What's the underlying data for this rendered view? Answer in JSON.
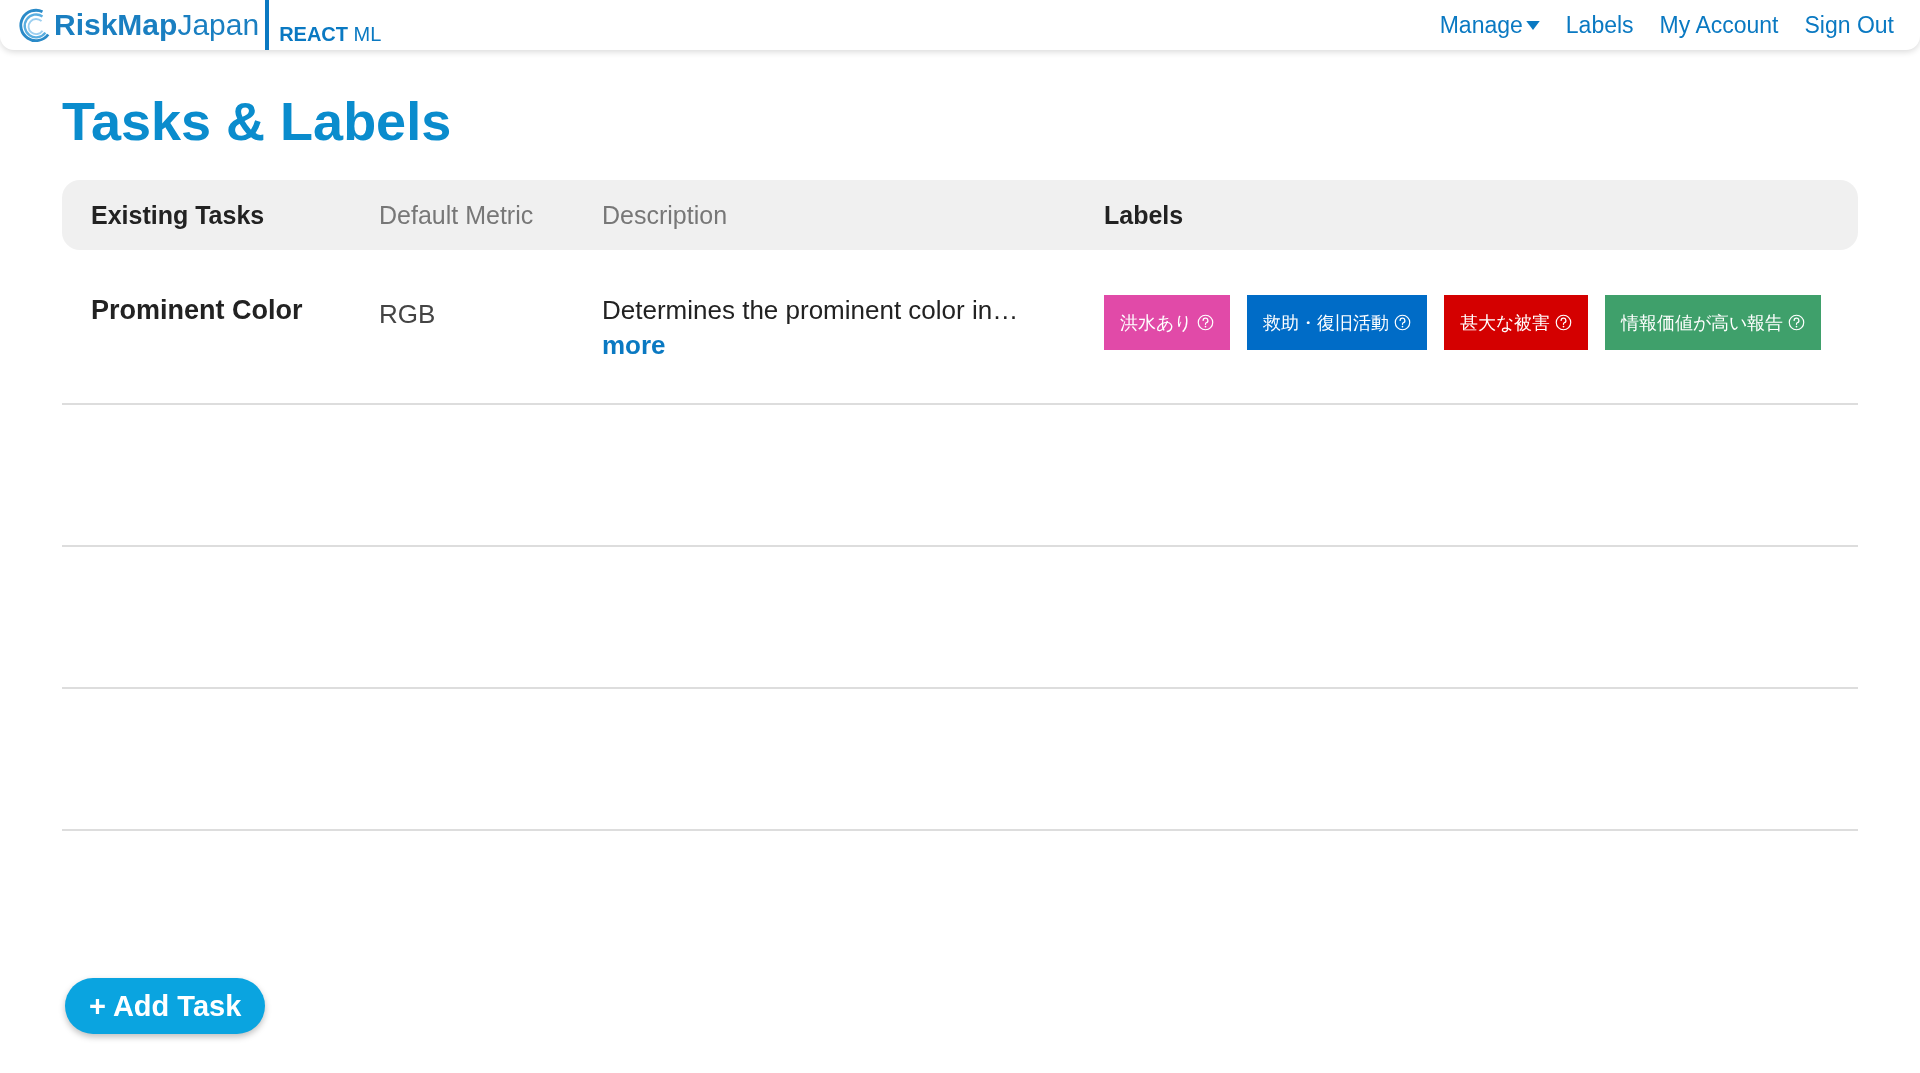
{
  "header": {
    "brand_bold": "RiskMap",
    "brand_light": "Japan",
    "product_bold": "REACT",
    "product_light": "ML",
    "nav": [
      {
        "label": "Manage",
        "kind": "dropdown"
      },
      {
        "label": "Labels",
        "kind": "link"
      },
      {
        "label": "My Account",
        "kind": "link"
      },
      {
        "label": "Sign Out",
        "kind": "link"
      }
    ]
  },
  "title": "Tasks & Labels",
  "table": {
    "columns": [
      {
        "label": "Existing Tasks",
        "bold": true
      },
      {
        "label": "Default Metric",
        "bold": false
      },
      {
        "label": "Description",
        "bold": false
      },
      {
        "label": "Labels",
        "bold": true
      }
    ],
    "rows": [
      {
        "task": "Prominent Color",
        "metric": "RGB",
        "description": "Determines the prominent color in…",
        "more": "more",
        "labels": [
          {
            "text": "洪水あり",
            "color": "#e14aa8"
          },
          {
            "text": "救助・復旧活動",
            "color": "#006cc7"
          },
          {
            "text": "甚大な被害",
            "color": "#d40000"
          },
          {
            "text": "情報価値が高い報告",
            "color": "#3fa06b"
          }
        ]
      }
    ]
  },
  "add_button": "+ Add Task"
}
